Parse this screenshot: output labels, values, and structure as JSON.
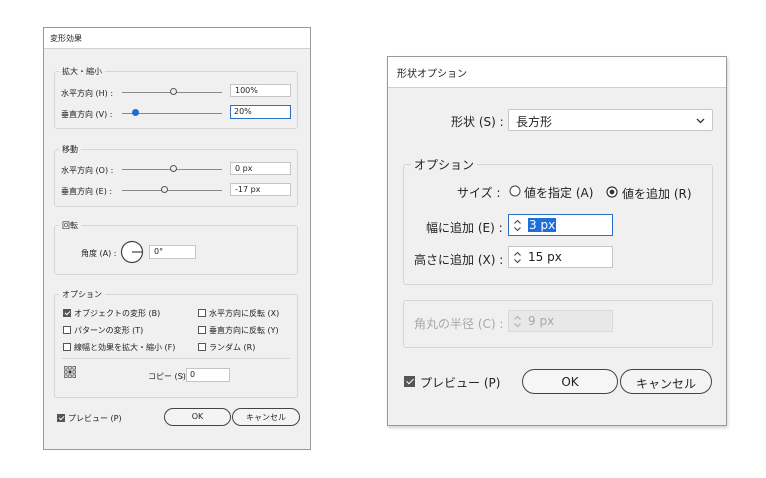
{
  "left_dialog": {
    "title": "変形効果",
    "scale": {
      "legend": "拡大・縮小",
      "horizontal_label": "水平方向 (H) :",
      "horizontal_value": "100%",
      "vertical_label": "垂直方向 (V) :",
      "vertical_value": "20%"
    },
    "move": {
      "legend": "移動",
      "horizontal_label": "水平方向 (O) :",
      "horizontal_value": "0 px",
      "vertical_label": "垂直方向 (E) :",
      "vertical_value": "-17 px"
    },
    "rotate": {
      "legend": "回転",
      "angle_label": "角度 (A) :",
      "angle_value": "0°"
    },
    "options": {
      "legend": "オプション",
      "transform_objects": "オブジェクトの変形 (B)",
      "transform_patterns": "パターンの変形 (T)",
      "scale_strokes": "線幅と効果を拡大・縮小 (F)",
      "reflect_x": "水平方向に反転 (X)",
      "reflect_y": "垂直方向に反転 (Y)",
      "random": "ランダム (R)",
      "copies_label": "コピー (S)",
      "copies_value": "0"
    },
    "preview_label": "プレビュー (P)",
    "ok_label": "OK",
    "cancel_label": "キャンセル"
  },
  "right_dialog": {
    "title": "形状オプション",
    "shape_label": "形状 (S) :",
    "shape_value": "長方形",
    "options_legend": "オプション",
    "size_label": "サイズ :",
    "size_option_absolute": "値を指定 (A)",
    "size_option_relative": "値を追加 (R)",
    "extra_width_label": "幅に追加 (E) :",
    "extra_width_value": "3 px",
    "extra_height_label": "高さに追加 (X) :",
    "extra_height_value": "15 px",
    "corner_radius_label": "角丸の半径 (C) :",
    "corner_radius_value": "9 px",
    "preview_label": "プレビュー (P)",
    "ok_label": "OK",
    "cancel_label": "キャンセル"
  }
}
